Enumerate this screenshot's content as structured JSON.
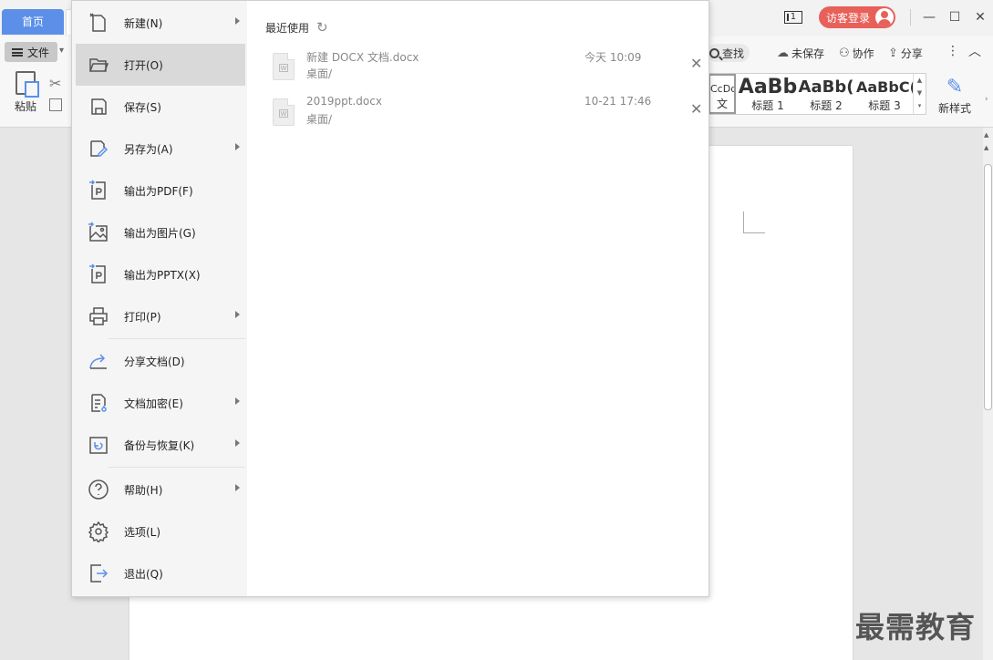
{
  "tabs": {
    "home": "首页"
  },
  "topbar": {
    "page_indicator": "1",
    "login_label": "访客登录",
    "minimize": "—",
    "maximize": "☐",
    "close": "✕"
  },
  "ribbon": {
    "file_label": "文件",
    "paste_label": "粘贴",
    "find_label": "查找",
    "unsaved_label": "未保存",
    "collab_label": "协作",
    "share_label": "分享",
    "styles": [
      {
        "sample": "CcDd",
        "name": "文"
      },
      {
        "sample": "AaBb",
        "name": "标题 1"
      },
      {
        "sample": "AaBb(",
        "name": "标题 2"
      },
      {
        "sample": "AaBbC(",
        "name": "标题 3"
      }
    ],
    "new_style_label": "新样式"
  },
  "file_menu": {
    "items": [
      {
        "label": "新建(N)",
        "icon": "new-doc-icon",
        "submenu": true
      },
      {
        "label": "打开(O)",
        "icon": "folder-open-icon",
        "submenu": false,
        "active": true
      },
      {
        "label": "保存(S)",
        "icon": "save-icon",
        "submenu": false
      },
      {
        "label": "另存为(A)",
        "icon": "save-as-icon",
        "submenu": true
      },
      {
        "label": "输出为PDF(F)",
        "icon": "export-pdf-icon",
        "submenu": false
      },
      {
        "label": "输出为图片(G)",
        "icon": "export-image-icon",
        "submenu": false
      },
      {
        "label": "输出为PPTX(X)",
        "icon": "export-pptx-icon",
        "submenu": false
      },
      {
        "label": "打印(P)",
        "icon": "print-icon",
        "submenu": true
      },
      {
        "label": "分享文档(D)",
        "icon": "share-icon",
        "submenu": false
      },
      {
        "label": "文档加密(E)",
        "icon": "encrypt-icon",
        "submenu": true
      },
      {
        "label": "备份与恢复(K)",
        "icon": "backup-icon",
        "submenu": true
      },
      {
        "label": "帮助(H)",
        "icon": "help-icon",
        "submenu": true
      },
      {
        "label": "选项(L)",
        "icon": "settings-icon",
        "submenu": false
      },
      {
        "label": "退出(Q)",
        "icon": "exit-icon",
        "submenu": false
      }
    ]
  },
  "recent": {
    "heading": "最近使用",
    "files": [
      {
        "name": "新建 DOCX 文档.docx",
        "path": "桌面/",
        "time": "今天 10:09"
      },
      {
        "name": "2019ppt.docx",
        "path": "桌面/",
        "time": "10-21 17:46"
      }
    ]
  },
  "watermark": "最需教育"
}
